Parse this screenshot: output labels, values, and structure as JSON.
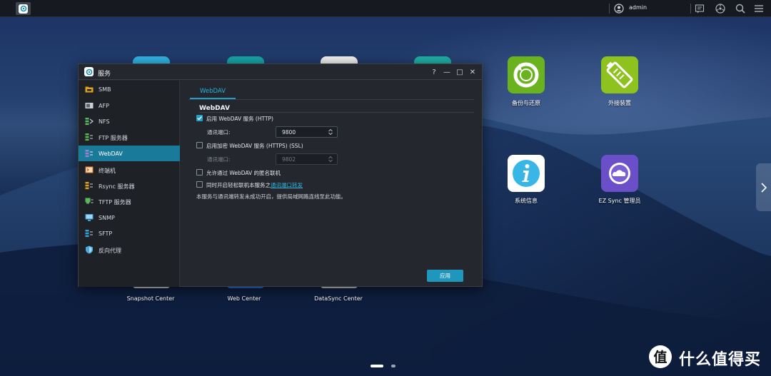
{
  "taskbar": {
    "username": "admin",
    "icons": [
      "main-menu-icon",
      "user-icon",
      "notifications-icon",
      "widgets-icon",
      "search-icon",
      "options-icon"
    ]
  },
  "desktop": {
    "icons": [
      {
        "label": "备份与还原",
        "icon": "backup-restore-icon",
        "color": "#6ab31f"
      },
      {
        "label": "外接装置",
        "icon": "external-devices-icon",
        "color": "#8dc21f"
      },
      {
        "label": "系统信息",
        "icon": "system-info-icon",
        "color": "#38b6e6"
      },
      {
        "label": "EZ Sync 管理员",
        "icon": "ez-sync-icon",
        "color": "#6a4fc9"
      },
      {
        "label": "Snapshot Center",
        "icon": "snapshot-center-icon"
      },
      {
        "label": "Web Center",
        "icon": "web-center-icon"
      },
      {
        "label": "DataSync Center",
        "icon": "datasync-center-icon"
      }
    ]
  },
  "window": {
    "title": "服务",
    "controls": {
      "help": "?",
      "minimize": "—",
      "maximize": "□",
      "close": "✕"
    },
    "sidebar": [
      {
        "label": "SMB",
        "icon": "smb-icon",
        "color": "#e0a21a"
      },
      {
        "label": "AFP",
        "icon": "afp-icon",
        "color": "#c9ced4"
      },
      {
        "label": "NFS",
        "icon": "nfs-icon",
        "color": "#5cb85c"
      },
      {
        "label": "FTP 服务器",
        "icon": "ftp-icon",
        "color": "#5cb85c"
      },
      {
        "label": "WebDAV",
        "icon": "webdav-icon",
        "color": "#9b7fd4",
        "active": true
      },
      {
        "label": "终端机",
        "icon": "terminal-icon",
        "color": "#e07b2a"
      },
      {
        "label": "Rsync 服务器",
        "icon": "rsync-icon",
        "color": "#e0a21a"
      },
      {
        "label": "TFTP 服务器",
        "icon": "tftp-icon",
        "color": "#5cb85c"
      },
      {
        "label": "SNMP",
        "icon": "snmp-icon",
        "color": "#3aa0d8"
      },
      {
        "label": "SFTP",
        "icon": "sftp-icon",
        "color": "#3aa0d8"
      },
      {
        "label": "反向代理",
        "icon": "reverse-proxy-icon",
        "color": "#4aa8e0"
      }
    ],
    "tab": "WebDAV",
    "section_title": "WebDAV",
    "options": {
      "http": {
        "label": "启用 WebDAV 服务 (HTTP)",
        "checked": true,
        "port_label": "通讯端口:",
        "port": "9800"
      },
      "https": {
        "label": "启用加密 WebDAV 服务 (HTTPS) (SSL)",
        "checked": false,
        "port_label": "通讯端口:",
        "port": "9802"
      },
      "anonymous": {
        "label": "允许通过 WebDAV 的匿名联机",
        "checked": false
      },
      "quickconnect": {
        "label_prefix": "同时开启轻松联机本服务之",
        "link": "通讯端口转发",
        "checked": false
      }
    },
    "note": "本服务与通讯端转发未成功开启，提供局域网路连线至此功能。",
    "apply_label": "应用"
  },
  "watermark": {
    "text": "什么值得买",
    "glyph": "值"
  }
}
